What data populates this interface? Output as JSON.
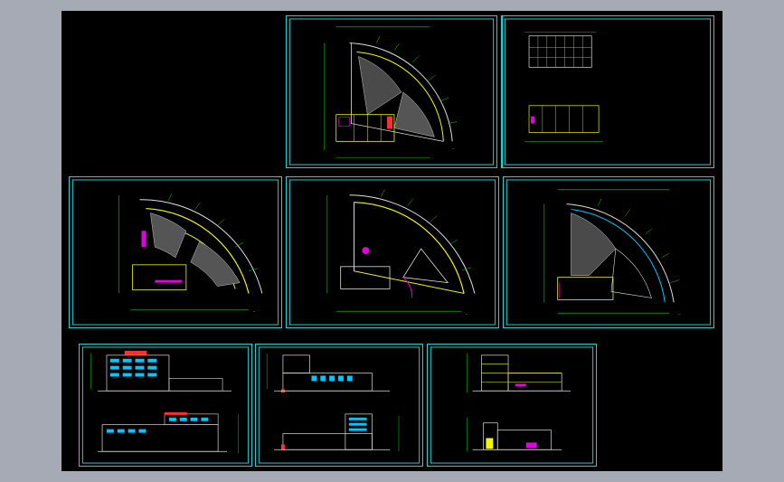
{
  "viewer": {
    "background": "#a6aab4",
    "canvas": "#000000"
  },
  "colors": {
    "frame": "#1fd0d4",
    "wall": "#f5f500",
    "dim": "#00e000",
    "axis": "#e0e0e0",
    "accent": "#e000e0",
    "hatch": "#c8c8c8",
    "window": "#00c8ff",
    "red": "#ff3030"
  },
  "sheets": [
    {
      "id": "s1",
      "kind": "plan-fan-top",
      "caption": "··"
    },
    {
      "id": "s2",
      "kind": "plan-section",
      "caption": "··"
    },
    {
      "id": "s3",
      "kind": "plan-fan-mid",
      "caption": "··"
    },
    {
      "id": "s4",
      "kind": "plan-fan-mid",
      "caption": "··"
    },
    {
      "id": "s5",
      "kind": "plan-fan-roof",
      "caption": "··"
    },
    {
      "id": "s6",
      "kind": "elevation",
      "caption": "··"
    },
    {
      "id": "s7",
      "kind": "elevation",
      "caption": "··"
    },
    {
      "id": "s8",
      "kind": "section-elevation",
      "caption": "··"
    }
  ]
}
